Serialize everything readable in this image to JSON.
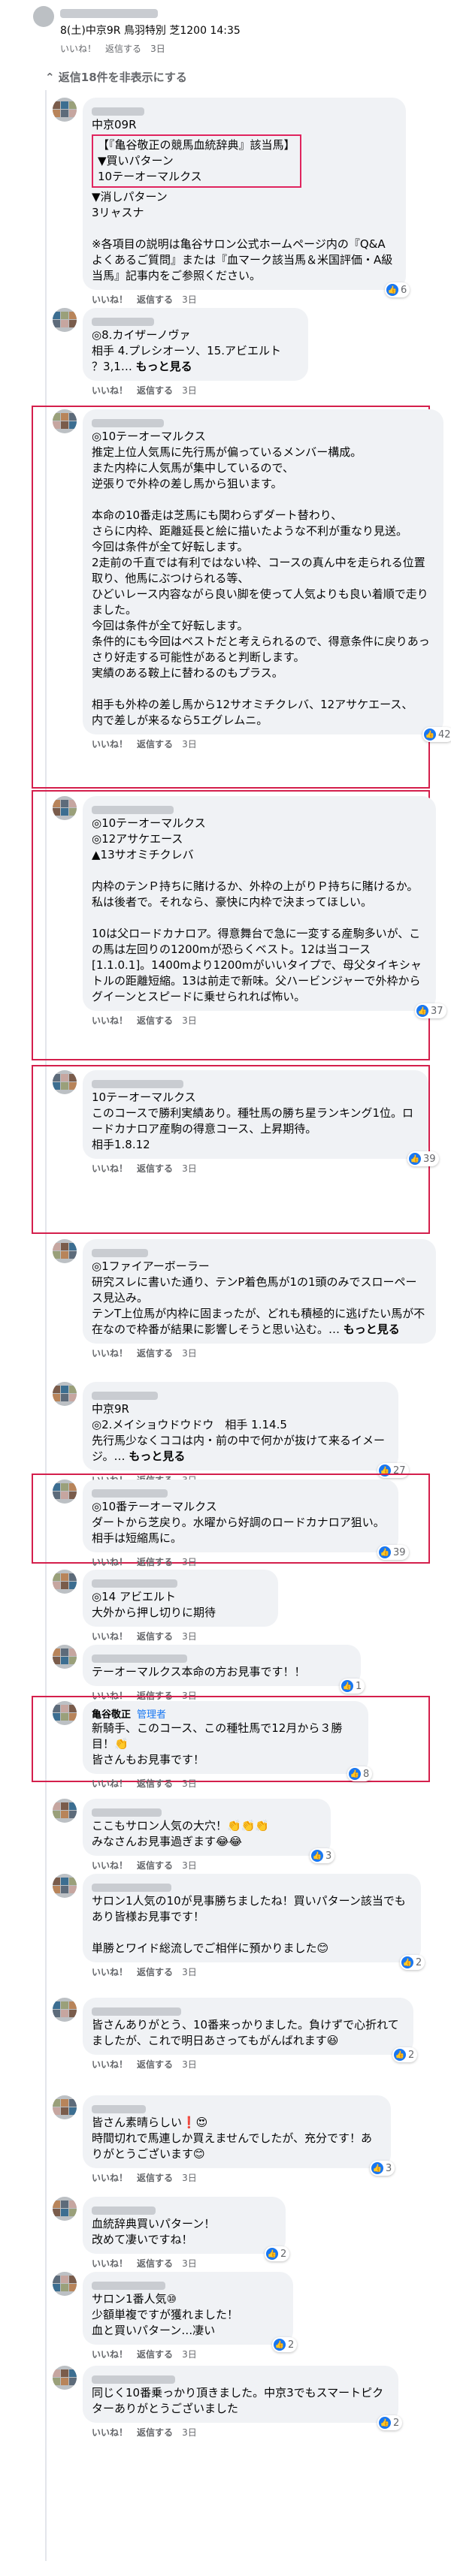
{
  "header": {
    "title": "8(土)中京9R 鳥羽特別 芝1200 14:35"
  },
  "actions": {
    "like": "いいね！",
    "reply": "返信する"
  },
  "hide_replies": "返信18件を非表示にする",
  "more": "もっと見る",
  "comments": [
    {
      "time": "3日",
      "lines": [
        "中京09R"
      ],
      "boxed": [
        "【『亀谷敬正の競馬血統辞典』該当馬】",
        "▼買いパターン",
        "10テーオーマルクス"
      ],
      "after": [
        "▼消しパターン",
        "3リャスナ",
        "",
        "※各項目の説明は亀谷サロン公式ホームページ内の『Q&A　よくあるご質問』または『血マーク該当馬＆米国評価・A級当馬』記事内をご参照ください。"
      ],
      "count": "6"
    },
    {
      "time": "3日",
      "lines": [
        "◎8.カイザーノヴァ",
        "相手 4.プレシオーソ、15.アビエルト",
        "？3,1… もっと見る"
      ]
    },
    {
      "time": "3日",
      "lines": [
        "◎10テーオーマルクス",
        "推定上位人気馬に先行馬が偏っているメンバー構成。",
        "また内枠に人気馬が集中しているので、",
        "逆張りで外枠の差し馬から狙います。",
        "",
        "本命の10番走は芝馬にも関わらずダート替わり、",
        "さらに内枠、距離延長と絵に描いたような不利が重なり見送。",
        "今回は条件が全て好転します。",
        "2走前の千直では有利ではない枠、コースの真ん中を走られる位置取り、他馬にぶつけられる等、",
        "ひどいレース内容ながら良い脚を使って人気よりも良い着順で走りました。",
        "今回は条件が全て好転します。",
        "条件的にも今回はベストだと考えられるので、得意条件に戻りあっさり好走する可能性があると判断します。",
        "実績のある鞍上に替わるのもプラス。",
        "",
        "相手も外枠の差し馬から12サオミチクレバ、12アサケエース、",
        "内で差しが来るなら5エグレムニ。"
      ],
      "count": "42"
    },
    {
      "time": "3日",
      "lines": [
        "◎10テーオーマルクス",
        "◎12アサケエース",
        "▲13サオミチクレバ",
        "",
        "内枠のテンＰ持ちに賭けるか、外枠の上がりＰ持ちに賭けるか。私は後者で。それなら、豪快に内枠で決まってほしい。",
        "",
        "10は父ロードカナロア。得意舞台で急に一変する産駒多いが、この馬は左回りの1200mが恐らくベスト。12は当コース[1.1.0.1]。1400mより1200mがいいタイプで、母父タイキシャトルの距離短縮。13は前走で新味。父ハービンジャーで外枠からグイーンとスピードに乗せられれば怖い。"
      ],
      "count": "37"
    },
    {
      "time": "3日",
      "lines": [
        "10テーオーマルクス",
        "このコースで勝利実績あり。種牡馬の勝ち星ランキング1位。ロードカナロア産駒の得意コース、上昇期待。",
        "相手1.8.12"
      ],
      "count": "39"
    },
    {
      "time": "3日",
      "lines": [
        "◎1ファイアーボーラー",
        "研究スレに書いた通り、テンP着色馬が1の1頭のみでスローペース見込み。",
        "テンT上位馬が内枠に固まったが、どれも積極的に逃げたい馬が不在なので枠番が結果に影響しそうと思い込む。… もっと見る"
      ]
    },
    {
      "time": "3日",
      "lines": [
        "中京9R",
        "◎2.メイショウドウドウ　相手 1.14.5",
        "先行馬少なくココは内・前の中で何かが抜けて来るイメージ。… もっと見る"
      ],
      "count": "27"
    },
    {
      "time": "3日",
      "lines": [
        "◎10番テーオーマルクス",
        "ダートから芝戻り。水曜から好調のロードカナロア狙い。相手は短縮馬に。"
      ],
      "count": "39"
    },
    {
      "time": "3日",
      "lines": [
        "◎14 アビエルト",
        "大外から押し切りに期待"
      ]
    },
    {
      "time": "3日",
      "lines": [
        "テーオーマルクス本命の方お見事です！！"
      ],
      "count": "1"
    },
    {
      "name": "亀谷敬正",
      "badge": "管理者",
      "time": "3日",
      "lines": [
        "新騎手、このコース、この種牡馬で12月から３勝目！👏",
        "皆さんもお見事です！"
      ],
      "count": "8"
    },
    {
      "time": "3日",
      "lines": [
        "ここもサロン人気の大穴！👏👏👏",
        "みなさんお見事過ぎます😂😂"
      ],
      "count": "3"
    },
    {
      "time": "3日",
      "lines": [
        "サロン1人気の10が見事勝ちましたね！買いパターン該当でもあり皆様お見事です！",
        "",
        "単勝とワイド総流しでご相伴に預かりました😊"
      ],
      "count": "2"
    },
    {
      "time": "3日",
      "lines": [
        "皆さんありがとう、10番来っかりました。負けずで心折れてましたが、これで明日あさってもがんばれます😆"
      ],
      "count": "2"
    },
    {
      "time": "3日",
      "lines": [
        "皆さん素晴らしい❗😍",
        "時間切れで馬連しか買えませんでしたが、充分です！ありがとうございます😊"
      ],
      "count": "3"
    },
    {
      "time": "3日",
      "lines": [
        "血統辞典買いパターン！",
        "改めて凄いですね！"
      ],
      "count": "2"
    },
    {
      "time": "3日",
      "lines": [
        "サロン1番人気⑩",
        "少額単複ですが獲れました！",
        "血と買いパターン…凄い"
      ],
      "count": "2"
    },
    {
      "time": "3日",
      "lines": [
        "同じく10番乗っかり頂きました。中京3でもスマートピクターありがとうございました"
      ],
      "count": "2"
    }
  ]
}
